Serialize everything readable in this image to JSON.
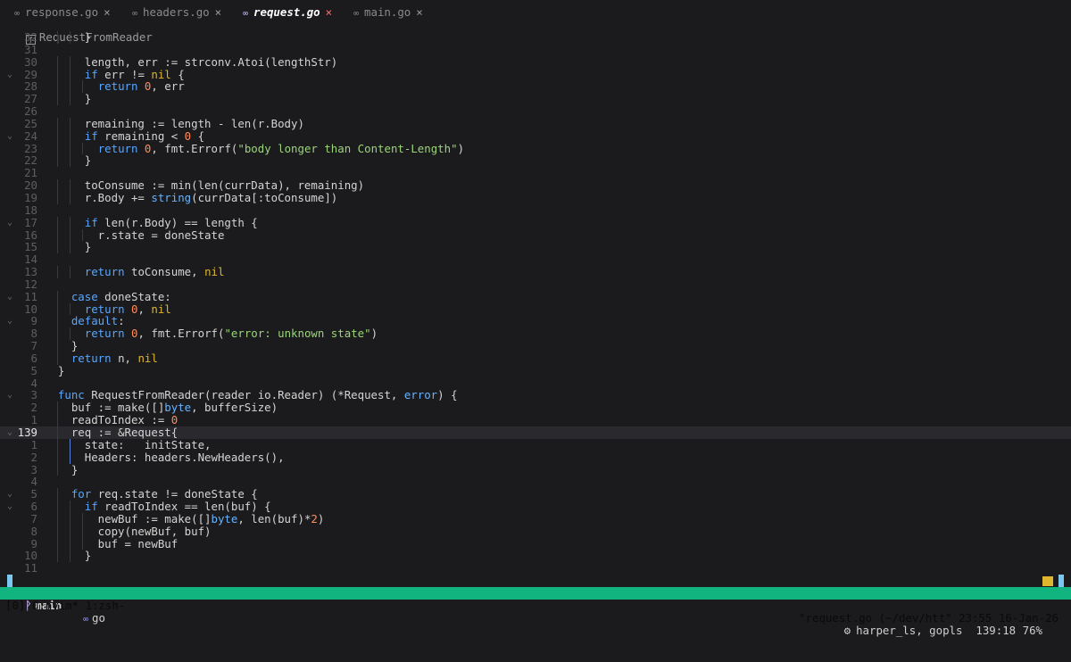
{
  "tabs": [
    {
      "name": "response.go",
      "icon": "go-file-icon",
      "close": "×",
      "active": false
    },
    {
      "name": "headers.go",
      "icon": "go-file-icon",
      "close": "×",
      "active": false
    },
    {
      "name": "request.go",
      "icon": "go-file-icon",
      "close": "×",
      "active": true
    },
    {
      "name": "main.go",
      "icon": "go-file-icon",
      "close": "×",
      "active": false
    }
  ],
  "breadcrumb": {
    "symbol": "RequestFromReader",
    "icon": "function-icon"
  },
  "editor": {
    "lines": [
      {
        "n": "32",
        "fold": "",
        "text": "      }"
      },
      {
        "n": "31",
        "fold": "",
        "text": ""
      },
      {
        "n": "30",
        "fold": "",
        "text": "      length, err := strconv.Atoi(lengthStr)"
      },
      {
        "n": "29",
        "fold": "v",
        "text": "      if err != nil {"
      },
      {
        "n": "28",
        "fold": "",
        "text": "        return 0, err"
      },
      {
        "n": "27",
        "fold": "",
        "text": "      }"
      },
      {
        "n": "26",
        "fold": "",
        "text": ""
      },
      {
        "n": "25",
        "fold": "",
        "text": "      remaining := length - len(r.Body)"
      },
      {
        "n": "24",
        "fold": "v",
        "text": "      if remaining < 0 {"
      },
      {
        "n": "23",
        "fold": "",
        "text": "        return 0, fmt.Errorf(\"body longer than Content-Length\")"
      },
      {
        "n": "22",
        "fold": "",
        "text": "      }"
      },
      {
        "n": "21",
        "fold": "",
        "text": ""
      },
      {
        "n": "20",
        "fold": "",
        "text": "      toConsume := min(len(currData), remaining)"
      },
      {
        "n": "19",
        "fold": "",
        "text": "      r.Body += string(currData[:toConsume])"
      },
      {
        "n": "18",
        "fold": "",
        "text": ""
      },
      {
        "n": "17",
        "fold": "v",
        "text": "      if len(r.Body) == length {"
      },
      {
        "n": "16",
        "fold": "",
        "text": "        r.state = doneState"
      },
      {
        "n": "15",
        "fold": "",
        "text": "      }"
      },
      {
        "n": "14",
        "fold": "",
        "text": ""
      },
      {
        "n": "13",
        "fold": "",
        "text": "      return toConsume, nil"
      },
      {
        "n": "12",
        "fold": "",
        "text": ""
      },
      {
        "n": "11",
        "fold": "v",
        "text": "    case doneState:"
      },
      {
        "n": "10",
        "fold": "",
        "text": "      return 0, nil"
      },
      {
        "n": "9",
        "fold": "v",
        "text": "    default:"
      },
      {
        "n": "8",
        "fold": "",
        "text": "      return 0, fmt.Errorf(\"error: unknown state\")"
      },
      {
        "n": "7",
        "fold": "",
        "text": "    }"
      },
      {
        "n": "6",
        "fold": "",
        "text": "    return n, nil"
      },
      {
        "n": "5",
        "fold": "",
        "text": "  }"
      },
      {
        "n": "4",
        "fold": "",
        "text": ""
      },
      {
        "n": "3",
        "fold": "v",
        "text": "  func RequestFromReader(reader io.Reader) (*Request, error) {"
      },
      {
        "n": "2",
        "fold": "",
        "text": "    buf := make([]byte, bufferSize)"
      },
      {
        "n": "1",
        "fold": "",
        "text": "    readToIndex := 0"
      },
      {
        "n": "139",
        "fold": "v",
        "text": "    req := &Request{",
        "current": true
      },
      {
        "n": "1",
        "fold": "",
        "text": "      state:   initState,"
      },
      {
        "n": "2",
        "fold": "",
        "text": "      Headers: headers.NewHeaders(),"
      },
      {
        "n": "3",
        "fold": "",
        "text": "    }"
      },
      {
        "n": "4",
        "fold": "",
        "text": ""
      },
      {
        "n": "5",
        "fold": "v",
        "text": "    for req.state != doneState {"
      },
      {
        "n": "6",
        "fold": "v",
        "text": "      if readToIndex == len(buf) {"
      },
      {
        "n": "7",
        "fold": "",
        "text": "        newBuf := make([]byte, len(buf)*2)"
      },
      {
        "n": "8",
        "fold": "",
        "text": "        copy(newBuf, buf)"
      },
      {
        "n": "9",
        "fold": "",
        "text": "        buf = newBuf"
      },
      {
        "n": "10",
        "fold": "",
        "text": "      }"
      },
      {
        "n": "11",
        "fold": "",
        "text": ""
      }
    ]
  },
  "statusline": {
    "branch": "main",
    "branch_icon": "git-branch-icon",
    "filetype": "go",
    "filetype_icon": "go-file-icon",
    "lsp": "harper_ls, gopls",
    "lsp_icon": "gear-icon",
    "position": "139:18",
    "percent": "76%"
  },
  "tmux": {
    "left": "[0] 0:nvim* 1:zsh-",
    "right": "\"request.go (~/dev/htt\" 23:55 16-Jan-26"
  },
  "colors": {
    "background": "#1b1b1d",
    "keyword": "#58a6ff",
    "string": "#9bd47a",
    "number": "#ff8c5a",
    "nil": "#e0b62e",
    "tmux_bar": "#11b37f",
    "mode_indicator": "#7cc7f0"
  }
}
